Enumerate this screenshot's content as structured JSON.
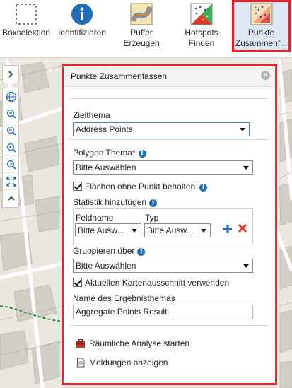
{
  "toolbar": {
    "tools": [
      {
        "label": "Boxselektion",
        "icon": "box-selection-icon"
      },
      {
        "label": "Identifizieren",
        "icon": "info-icon"
      },
      {
        "label_line1": "Puffer",
        "label_line2": "Erzeugen",
        "icon": "buffer-icon"
      },
      {
        "label_line1": "Hotspots",
        "label_line2": "Finden",
        "icon": "hotspot-icon"
      },
      {
        "label_line1": "Punkte",
        "label_line2": "Zusammenf...",
        "icon": "aggregate-points-icon",
        "active": true
      }
    ]
  },
  "map_tools": [
    "expand-panel-icon",
    "globe-icon",
    "zoom-in-icon",
    "zoom-out-icon",
    "previous-extent-icon",
    "next-extent-icon",
    "full-extent-icon",
    "collapse-up-icon"
  ],
  "panel": {
    "title": "Punkte Zusammenfassen",
    "zielthema": {
      "label": "Zielthema",
      "value": "Address Points"
    },
    "polygon_thema": {
      "label": "Polygon Thema",
      "required_mark": "*",
      "value": "Bitte Auswählen"
    },
    "keep_empty": {
      "label": "Flächen ohne Punkt behalten",
      "checked": true
    },
    "statistik": {
      "label": "Statistik hinzufügen",
      "feldname_header": "Feldname",
      "typ_header": "Typ",
      "feldname_value": "Bitte Ausw...",
      "typ_value": "Bitte Ausw..."
    },
    "gruppieren": {
      "label": "Gruppieren über",
      "value": "Bitte Auswählen"
    },
    "current_extent": {
      "label": "Aktuellen Kartenausschnitt verwenden",
      "checked": true
    },
    "result_name": {
      "label": "Name des Ergebnisthemas",
      "value": "Aggregate Points Result"
    },
    "actions": {
      "start": "Räumliche Analyse starten",
      "messages": "Meldungen anzeigen"
    }
  },
  "colors": {
    "highlight": "#e4232b",
    "accent_blue": "#1f6fb8",
    "remove_red": "#d9382b"
  }
}
